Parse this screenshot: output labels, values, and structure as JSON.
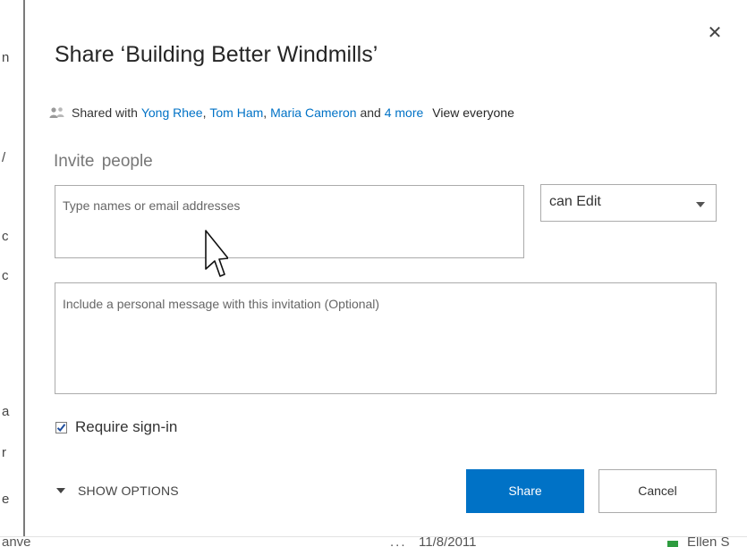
{
  "dialog": {
    "title": "Share ‘Building Better Windmills’",
    "close_glyph": "✕",
    "shared_with": {
      "prefix": "Shared with",
      "people": [
        "Yong Rhee",
        "Tom Ham",
        "Maria Cameron"
      ],
      "separator": ", ",
      "and_text": " and ",
      "more_link": "4 more",
      "view_everyone": "View everyone",
      "icon": "people-icon"
    },
    "invite_label": "Invite people",
    "names_input": {
      "placeholder": "Type names or email addresses",
      "value": ""
    },
    "permission": {
      "selected": "can Edit"
    },
    "message_input": {
      "placeholder": "Include a personal message with this invitation (Optional)",
      "value": ""
    },
    "require_signin": {
      "label": "Require sign-in",
      "checked": true
    },
    "show_options_label": "SHOW OPTIONS",
    "share_label": "Share",
    "cancel_label": "Cancel"
  },
  "background_page": {
    "left_fragments": [
      "n",
      "/",
      "c",
      "c",
      "a",
      "r",
      "e"
    ],
    "bottom_row": [
      "anve",
      "...",
      "11/8/2011",
      "Ellen S"
    ]
  },
  "colors": {
    "accent": "#0072c6",
    "link": "#0072c6",
    "border": "#ababab",
    "status_green": "#2e9c3f"
  }
}
